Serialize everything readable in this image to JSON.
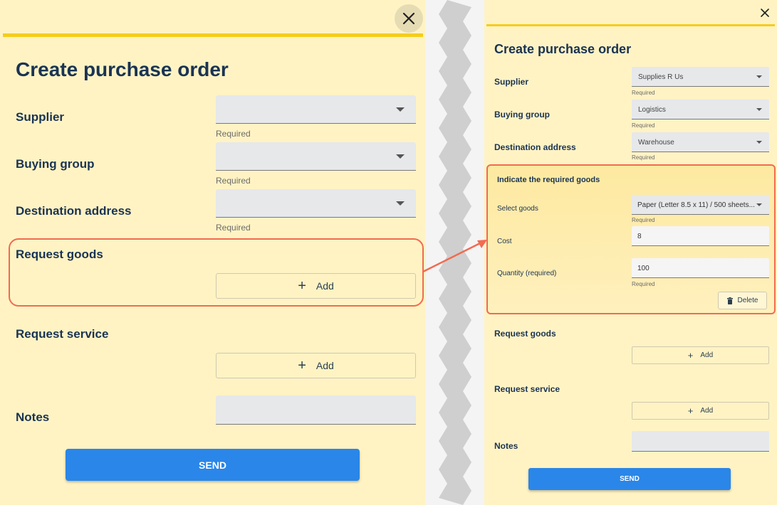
{
  "left_panel": {
    "title": "Create purchase order",
    "close_icon": "close-icon",
    "fields": [
      {
        "label": "Supplier",
        "value": "",
        "helper": "Required"
      },
      {
        "label": "Buying group",
        "value": "",
        "helper": "Required"
      },
      {
        "label": "Destination address",
        "value": "",
        "helper": "Required"
      }
    ],
    "request_goods": {
      "label": "Request goods",
      "add_label": "Add"
    },
    "request_service": {
      "label": "Request service",
      "add_label": "Add"
    },
    "notes": {
      "label": "Notes",
      "value": ""
    },
    "send_label": "SEND"
  },
  "right_panel": {
    "title": "Create purchase order",
    "close_icon": "close-icon",
    "fields": [
      {
        "label": "Supplier",
        "value": "Supplies R Us",
        "helper": "Required"
      },
      {
        "label": "Buying group",
        "value": "Logistics",
        "helper": "Required"
      },
      {
        "label": "Destination address",
        "value": "Warehouse",
        "helper": "Required"
      }
    ],
    "goods_item": {
      "title": "Indicate the required goods",
      "select_goods_label": "Select goods",
      "select_goods_value": "Paper (Letter 8.5 x 11) / 500 sheets...",
      "select_goods_helper": "Required",
      "cost_label": "Cost",
      "cost_value": "8",
      "quantity_label": "Quantity (required)",
      "quantity_value": "100",
      "quantity_helper": "Required",
      "delete_label": "Delete",
      "delete_icon": "trash-icon"
    },
    "request_goods": {
      "label": "Request goods",
      "add_label": "Add"
    },
    "request_service": {
      "label": "Request service",
      "add_label": "Add"
    },
    "notes": {
      "label": "Notes",
      "value": ""
    },
    "send_label": "SEND"
  },
  "colors": {
    "panel_bg": "#fff3c4",
    "accent_bar": "#f5cd1c",
    "highlight": "#f26a51",
    "send_button": "#2a86e8",
    "heading_text": "#1a3352"
  }
}
